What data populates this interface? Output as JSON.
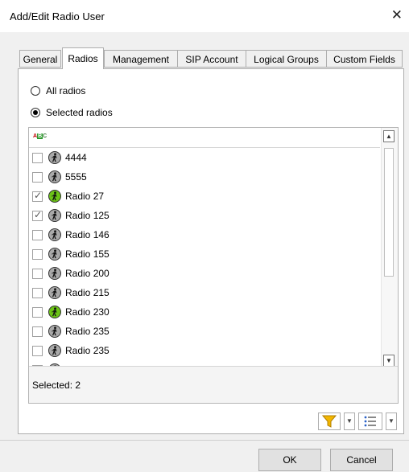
{
  "window": {
    "title": "Add/Edit Radio User",
    "close_icon": "close-icon"
  },
  "tabs": [
    {
      "label": "General",
      "active": false
    },
    {
      "label": "Radios",
      "active": true
    },
    {
      "label": "Management",
      "active": false
    },
    {
      "label": "SIP Account",
      "active": false
    },
    {
      "label": "Logical Groups",
      "active": false
    },
    {
      "label": "Custom Fields",
      "active": false
    }
  ],
  "mode": {
    "all_label": "All radios",
    "selected_label": "Selected radios",
    "selected": "selected"
  },
  "list": {
    "sort_icon": "sort-abc-icon",
    "items": [
      {
        "label": "4444",
        "checked": false,
        "icon_color": "gray"
      },
      {
        "label": "5555",
        "checked": false,
        "icon_color": "gray"
      },
      {
        "label": "Radio 27",
        "checked": true,
        "icon_color": "green"
      },
      {
        "label": "Radio 125",
        "checked": true,
        "icon_color": "gray"
      },
      {
        "label": "Radio 146",
        "checked": false,
        "icon_color": "gray"
      },
      {
        "label": "Radio 155",
        "checked": false,
        "icon_color": "gray"
      },
      {
        "label": "Radio 200",
        "checked": false,
        "icon_color": "gray"
      },
      {
        "label": "Radio 215",
        "checked": false,
        "icon_color": "gray"
      },
      {
        "label": "Radio 230",
        "checked": false,
        "icon_color": "green"
      },
      {
        "label": "Radio 235",
        "checked": false,
        "icon_color": "gray"
      },
      {
        "label": "Radio 235",
        "checked": false,
        "icon_color": "gray"
      },
      {
        "label": "",
        "checked": false,
        "icon_color": "gray"
      }
    ],
    "status": "Selected: 2"
  },
  "toolbar": {
    "filter_icon": "filter-icon",
    "list_view_icon": "list-view-icon"
  },
  "buttons": {
    "ok": "OK",
    "cancel": "Cancel"
  },
  "colors": {
    "radio_online": "#6cc417",
    "radio_offline": "#a9a9a9",
    "filter": "#f2b600"
  }
}
